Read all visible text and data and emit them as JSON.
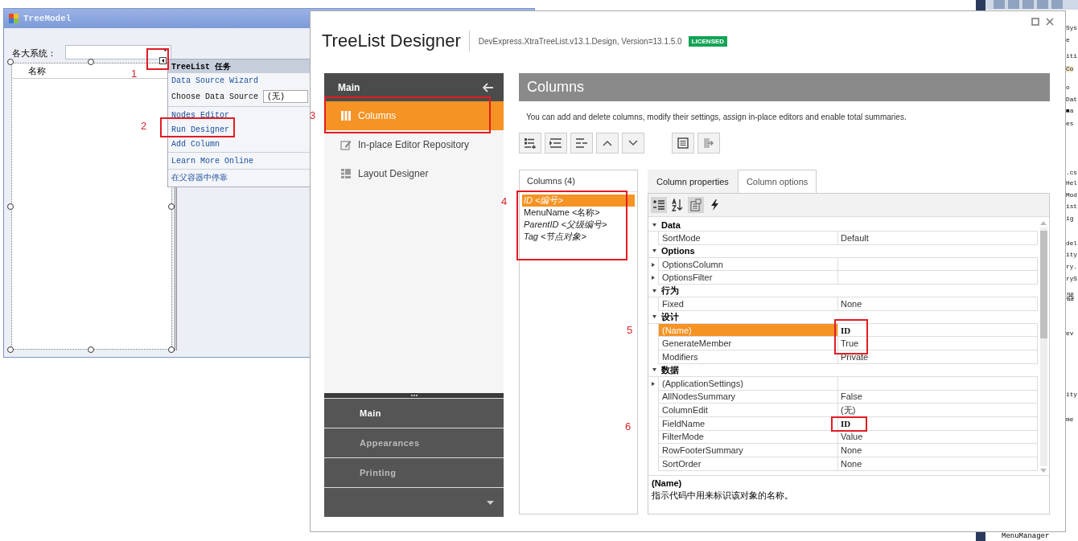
{
  "form": {
    "title": "TreeModel",
    "label": "各大系统：",
    "tree_header": "名称",
    "smart_tag": {
      "title": "TreeList 任务",
      "items": [
        {
          "kind": "link",
          "text": "Data Source Wizard",
          "separator": false
        },
        {
          "kind": "combo",
          "text": "Choose Data Source",
          "value": "(无)",
          "separator": false
        },
        {
          "kind": "link",
          "text": "Nodes Editor",
          "separator": true
        },
        {
          "kind": "link",
          "text": "Run Designer",
          "separator": false
        },
        {
          "kind": "link",
          "text": "Add Column",
          "separator": false
        },
        {
          "kind": "link",
          "text": "Learn More Online",
          "separator": true
        },
        {
          "kind": "link",
          "text": "在父容器中停靠",
          "separator": true
        }
      ]
    }
  },
  "designer": {
    "title": "TreeList Designer",
    "subtitle": "DevExpress.XtraTreeList.v13.1.Design, Version=13.1.5.0",
    "badge": "LICENSED",
    "nav": {
      "header": "Main",
      "items": [
        {
          "kind": "columns",
          "label": "Columns",
          "selected": true
        },
        {
          "kind": "editor",
          "label": "In-place Editor Repository",
          "selected": false
        },
        {
          "kind": "layout",
          "label": "Layout Designer",
          "selected": false
        }
      ],
      "groups": [
        {
          "label": "Main",
          "selected": true
        },
        {
          "label": "Appearances",
          "selected": false
        },
        {
          "label": "Printing",
          "selected": false
        }
      ]
    },
    "page": {
      "title": "Columns",
      "description": "You can add and delete columns, modify their settings, assign in-place editors and enable total summaries.",
      "columns_title": "Columns (4)",
      "columns": [
        {
          "text": "ID <编号>",
          "selected": true,
          "italic": true
        },
        {
          "text": "MenuName <名称>",
          "selected": false,
          "italic": false
        },
        {
          "text": "ParentID <父级编号>",
          "selected": false,
          "italic": true
        },
        {
          "text": "Tag <节点对象>",
          "selected": false,
          "italic": true
        }
      ],
      "tabs": [
        {
          "label": "Column properties",
          "selected": true
        },
        {
          "label": "Column options",
          "selected": false
        }
      ],
      "grid_tools": [
        {
          "kind": "categorized",
          "pressed": true
        },
        {
          "kind": "alphabetical",
          "pressed": false
        },
        {
          "kind": "pages",
          "pressed": true
        },
        {
          "kind": "events",
          "pressed": false
        }
      ],
      "properties": [
        {
          "kind": "category",
          "name": "Data"
        },
        {
          "kind": "property",
          "name": "SortMode",
          "value": "Default",
          "expandable": false,
          "selected": false,
          "modified": false
        },
        {
          "kind": "category",
          "name": "Options"
        },
        {
          "kind": "property",
          "name": "OptionsColumn",
          "expandable": true,
          "selected": false,
          "modified": false
        },
        {
          "kind": "property",
          "name": "OptionsFilter",
          "expandable": true,
          "selected": false,
          "modified": false
        },
        {
          "kind": "category",
          "name": "行为"
        },
        {
          "kind": "property",
          "name": "Fixed",
          "value": "None",
          "expandable": false,
          "selected": false,
          "modified": false
        },
        {
          "kind": "category",
          "name": "设计"
        },
        {
          "kind": "property",
          "name": "(Name)",
          "value": "ID",
          "expandable": false,
          "selected": true,
          "modified": true
        },
        {
          "kind": "property",
          "name": "GenerateMember",
          "value": "True",
          "expandable": false,
          "selected": false,
          "modified": false
        },
        {
          "kind": "property",
          "name": "Modifiers",
          "value": "Private",
          "expandable": false,
          "selected": false,
          "modified": false
        },
        {
          "kind": "category",
          "name": "数据"
        },
        {
          "kind": "property",
          "name": "(ApplicationSettings)",
          "expandable": true,
          "selected": false,
          "modified": false
        },
        {
          "kind": "property",
          "name": "AllNodesSummary",
          "value": "False",
          "expandable": false,
          "selected": false,
          "modified": false
        },
        {
          "kind": "property",
          "name": "ColumnEdit",
          "value": "(无)",
          "expandable": false,
          "selected": false,
          "modified": false
        },
        {
          "kind": "property",
          "name": "FieldName",
          "value": "ID",
          "expandable": false,
          "selected": false,
          "modified": true
        },
        {
          "kind": "property",
          "name": "FilterMode",
          "value": "Value",
          "expandable": false,
          "selected": false,
          "modified": false
        },
        {
          "kind": "property",
          "name": "RowFooterSummary",
          "value": "None",
          "expandable": false,
          "selected": false,
          "modified": false
        },
        {
          "kind": "property",
          "name": "SortOrder",
          "value": "None",
          "expandable": false,
          "selected": false,
          "modified": false
        }
      ],
      "help": {
        "title": "(Name)",
        "text": "指示代码中用来标识该对象的名称。"
      }
    }
  },
  "annotations": [
    "1",
    "2",
    "3",
    "4",
    "5",
    "6"
  ],
  "ide_fragments": [
    "Sys",
    "e",
    "iti",
    "Co",
    "o",
    "Dat",
    "■a",
    "es",
    ".cs",
    "Hel",
    "Mod",
    "ist",
    "ig",
    "del",
    "ity",
    "ry.",
    "ryS",
    "器",
    "ev",
    "ity",
    "me",
    "MenuManager"
  ]
}
